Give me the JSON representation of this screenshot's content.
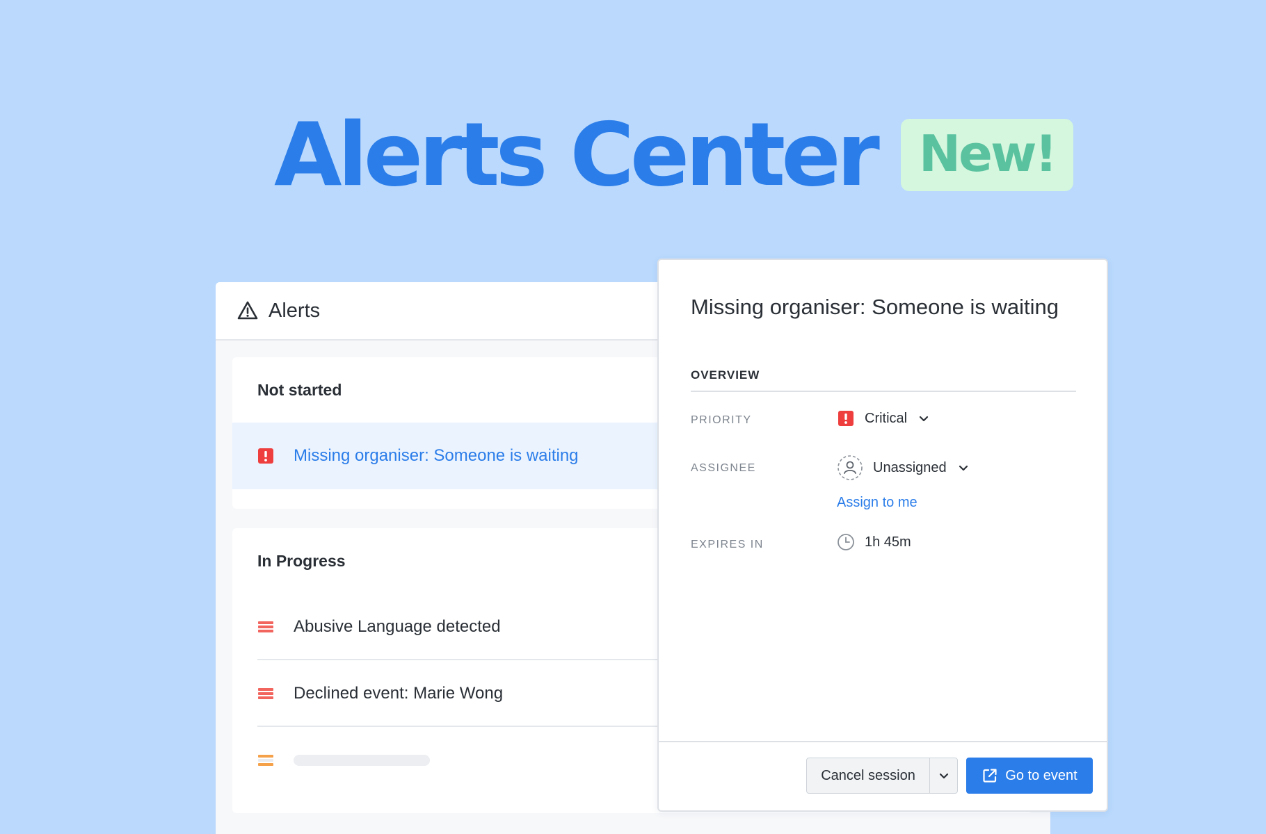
{
  "hero": {
    "title": "Alerts Center",
    "badge": "New!"
  },
  "alerts_panel": {
    "title": "Alerts",
    "title_icon": "warning-triangle-icon",
    "groups": [
      {
        "title": "Not started",
        "items": [
          {
            "label": "Missing organiser: Someone is waiting",
            "icon": "critical-exclamation-icon",
            "selected": true
          }
        ]
      },
      {
        "title": "In Progress",
        "items": [
          {
            "label": "Abusive Language detected",
            "icon": "priority-high-bars-icon"
          },
          {
            "label": "Declined event: Marie Wong",
            "icon": "priority-high-bars-icon"
          },
          {
            "label": "",
            "icon": "priority-medium-bars-icon",
            "placeholder": true
          }
        ]
      }
    ]
  },
  "detail": {
    "title": "Missing organiser: Someone is waiting",
    "section_label": "OVERVIEW",
    "priority": {
      "label": "PRIORITY",
      "value": "Critical",
      "icon": "critical-exclamation-icon"
    },
    "assignee": {
      "label": "ASSIGNEE",
      "value": "Unassigned",
      "icon": "user-placeholder-icon",
      "action": "Assign to me"
    },
    "expires": {
      "label": "EXPIRES IN",
      "value": "1h 45m",
      "icon": "clock-icon"
    },
    "footer": {
      "secondary_label": "Cancel session",
      "primary_label": "Go to event",
      "primary_icon": "external-link-icon"
    }
  },
  "colors": {
    "background": "#bad9fd",
    "accent": "#2b7de9",
    "badge_bg": "#d4f7de",
    "badge_text": "#5ac29f",
    "critical": "#ee3e3e",
    "high": "#f2645e",
    "medium": "#f5a14a"
  }
}
